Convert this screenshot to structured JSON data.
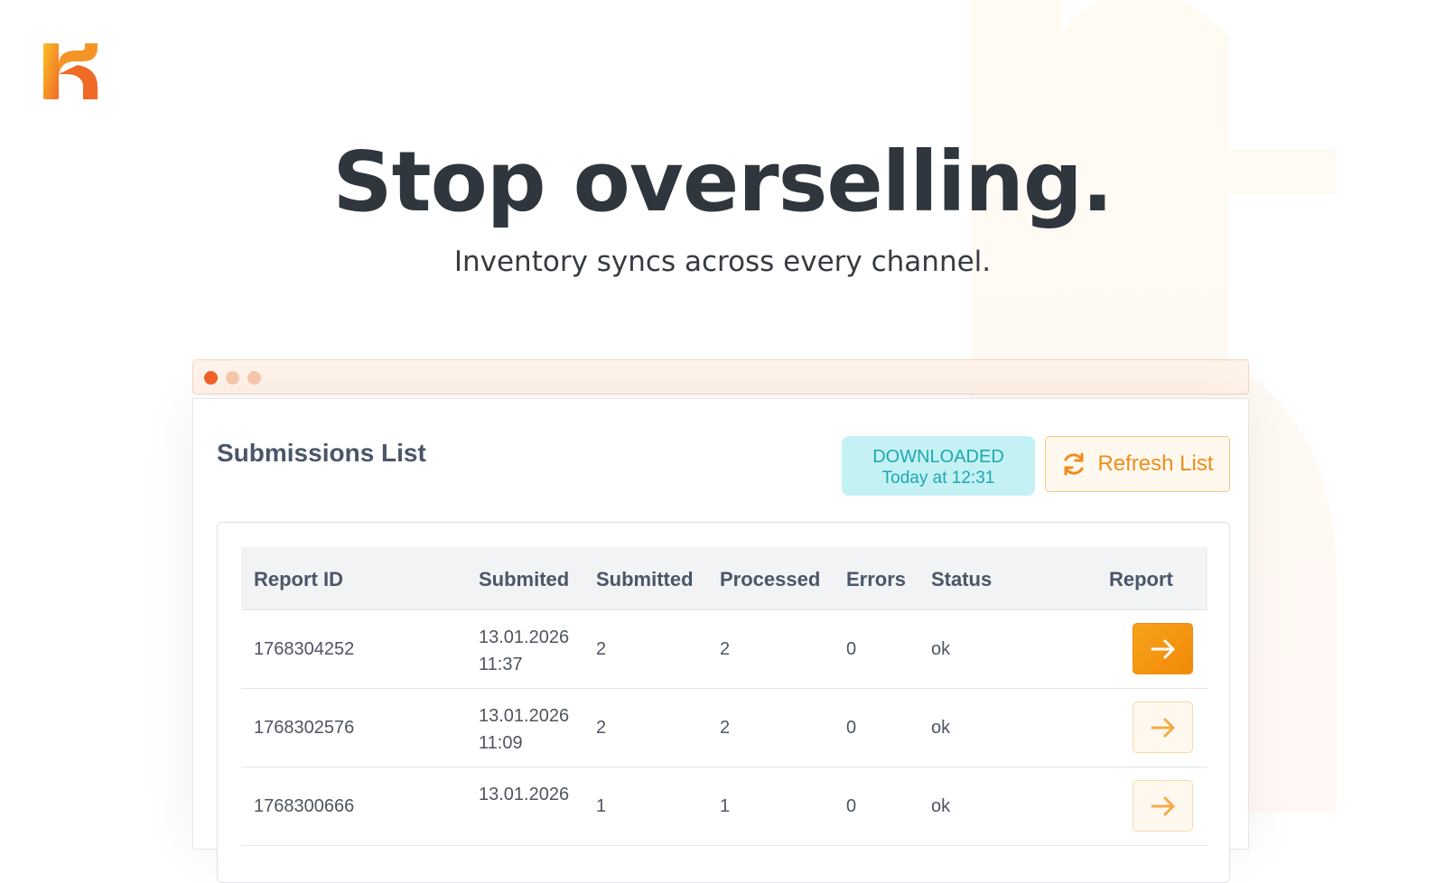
{
  "hero": {
    "title": "Stop overselling.",
    "subtitle": "Inventory syncs across every channel."
  },
  "brand": {
    "logo_icon": "k-logo-icon",
    "accent": "#f28a0a",
    "accent_light": "#fff8ee"
  },
  "panel": {
    "title": "Submissions List",
    "status_badge": {
      "line1": "DOWNLOADED",
      "line2": "Today at 12:31",
      "color": "#1fa8ae",
      "background": "#c4f1f4"
    },
    "refresh_button": {
      "label": "Refresh List",
      "icon": "refresh-icon"
    }
  },
  "table": {
    "columns": [
      "Report ID",
      "Submited",
      "Submitted",
      "Processed",
      "Errors",
      "Status",
      "Report"
    ],
    "rows": [
      {
        "report_id": "1768304252",
        "date": "13.01.2026",
        "time": "11:37",
        "submitted": "2",
        "processed": "2",
        "errors": "0",
        "status": "ok",
        "report_icon": "arrow-right-icon"
      },
      {
        "report_id": "1768302576",
        "date": "13.01.2026",
        "time": "11:09",
        "submitted": "2",
        "processed": "2",
        "errors": "0",
        "status": "ok",
        "report_icon": "arrow-right-icon"
      },
      {
        "report_id": "1768300666",
        "date": "13.01.2026",
        "time": "",
        "submitted": "1",
        "processed": "1",
        "errors": "0",
        "status": "ok",
        "report_icon": "arrow-right-icon"
      }
    ]
  }
}
